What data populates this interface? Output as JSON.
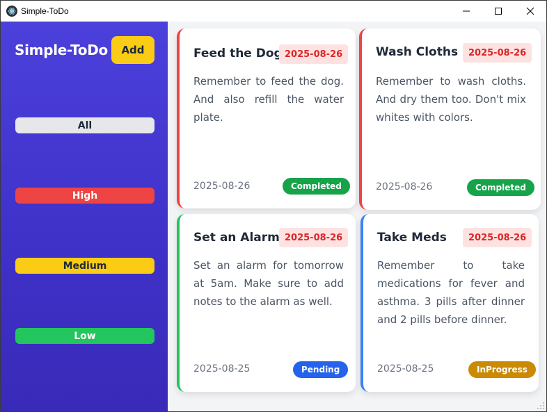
{
  "window": {
    "title": "Simple-ToDo",
    "controls": [
      "minimize",
      "maximize",
      "close"
    ]
  },
  "sidebar": {
    "app_name": "Simple-ToDo",
    "add_label": "Add",
    "filters": [
      {
        "label": "All",
        "color": "#e5e7eb"
      },
      {
        "label": "High",
        "color": "#ef4444"
      },
      {
        "label": "Medium",
        "color": "#facc15"
      },
      {
        "label": "Low",
        "color": "#22c55e"
      }
    ]
  },
  "cards": [
    {
      "title": "Feed the Dog",
      "due": "2025-08-26",
      "description": "Remember to feed the dog. And also refill the water plate.",
      "created": "2025-08-26",
      "status": "Completed",
      "priority_color": "#ef4444"
    },
    {
      "title": "Wash Cloths",
      "due": "2025-08-26",
      "description": "Remember to wash cloths. And dry them too. Don't mix whites with colors.",
      "created": "2025-08-26",
      "status": "Completed",
      "priority_color": "#ef4444"
    },
    {
      "title": "Set an Alarm",
      "due": "2025-08-26",
      "description": "Set an alarm for tomorrow at 5am. Make sure to add notes to the alarm as well.",
      "created": "2025-08-25",
      "status": "Pending",
      "priority_color": "#22c55e"
    },
    {
      "title": "Take Meds",
      "due": "2025-08-26",
      "description": "Remember to take medications for fever and asthma. 3 pills after dinner and 2 pills before dinner.",
      "created": "2025-08-25",
      "status": "InProgress",
      "priority_color": "#3b82f6"
    }
  ],
  "status_colors": {
    "Completed": "#16a34a",
    "Pending": "#2563eb",
    "InProgress": "#ca8a04"
  }
}
